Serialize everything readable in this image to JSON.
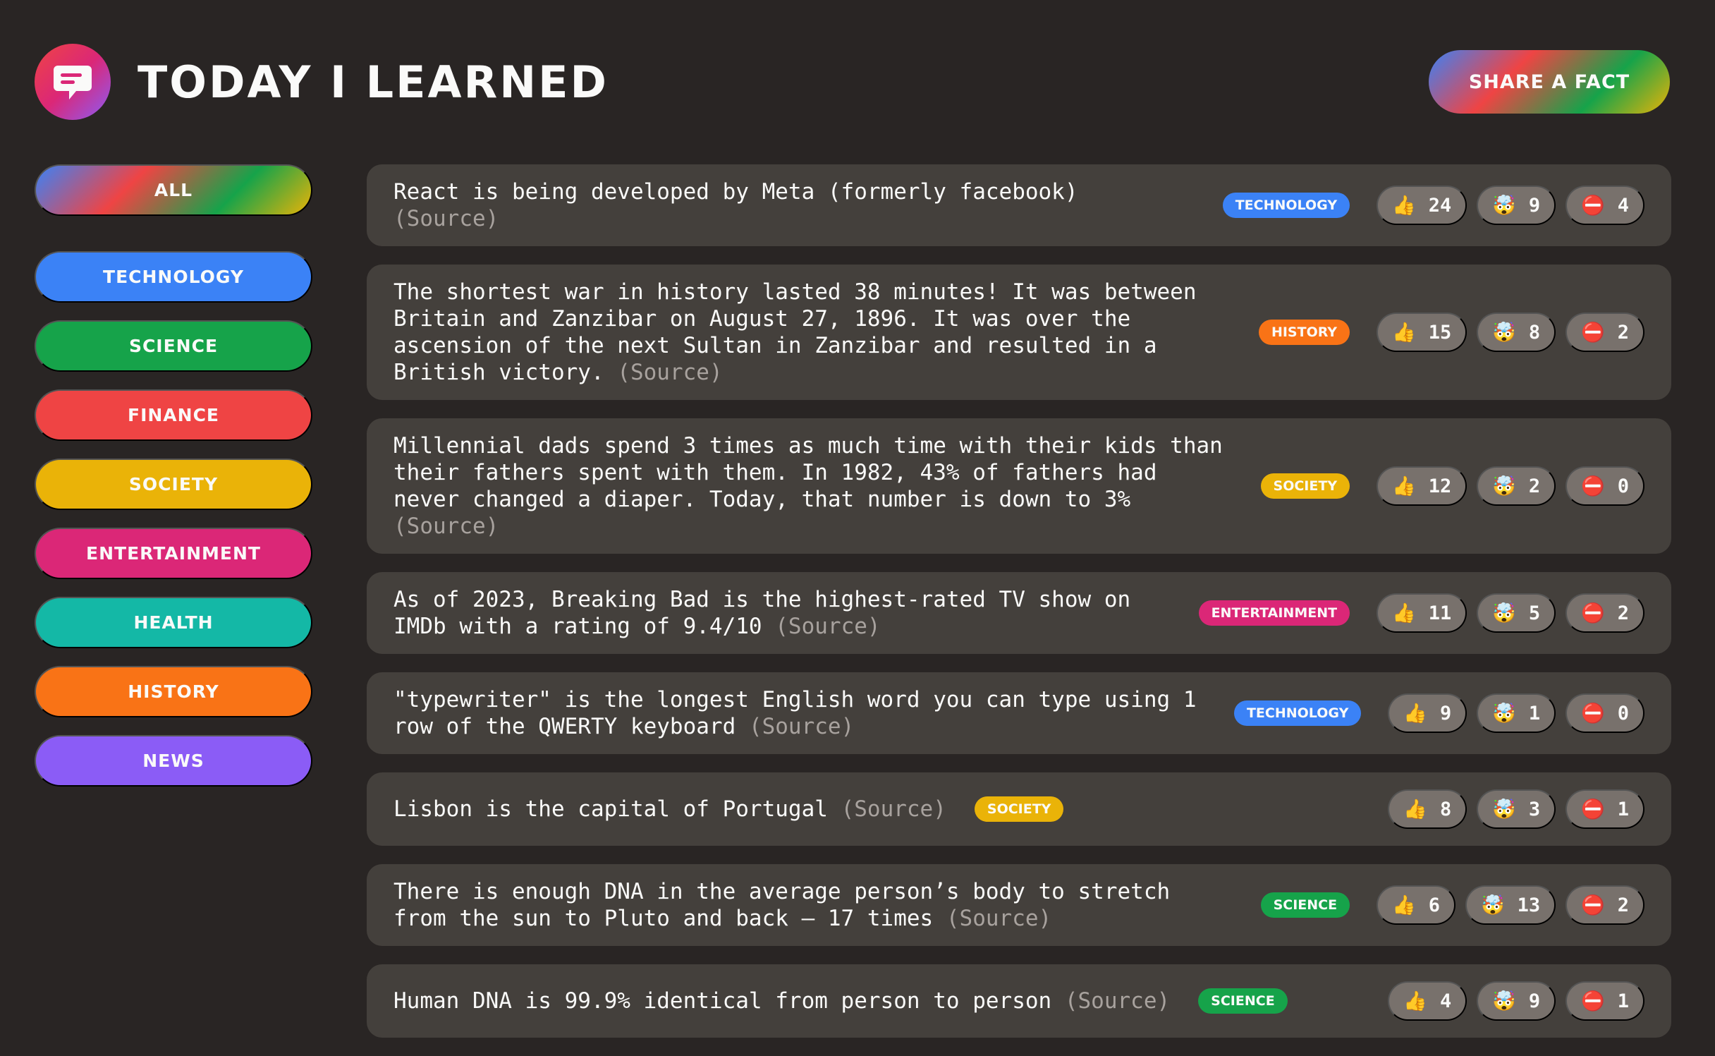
{
  "header": {
    "title": "Today I Learned",
    "share_label": "Share a fact"
  },
  "categories": [
    {
      "label": "All",
      "color": ""
    },
    {
      "label": "Technology",
      "color": "#3b82f6"
    },
    {
      "label": "Science",
      "color": "#16a34a"
    },
    {
      "label": "Finance",
      "color": "#ef4444"
    },
    {
      "label": "Society",
      "color": "#eab308"
    },
    {
      "label": "Entertainment",
      "color": "#db2777"
    },
    {
      "label": "Health",
      "color": "#14b8a6"
    },
    {
      "label": "History",
      "color": "#f97316"
    },
    {
      "label": "News",
      "color": "#8b5cf6"
    }
  ],
  "facts": [
    {
      "text": "React is being developed by Meta (formerly facebook)",
      "source": "(Source)",
      "category": "Technology",
      "color": "#3b82f6",
      "likes": "24",
      "mindblown": "9",
      "false": "4"
    },
    {
      "text": "The shortest war in history lasted 38 minutes! It was between Britain and Zanzibar on August 27, 1896. It was over the ascension of the next Sultan in Zanzibar and resulted in a British victory.",
      "source": "(Source)",
      "category": "History",
      "color": "#f97316",
      "likes": "15",
      "mindblown": "8",
      "false": "2"
    },
    {
      "text": "Millennial dads spend 3 times as much time with their kids than their fathers spent with them. In 1982, 43% of fathers had never changed a diaper. Today, that number is down to 3%",
      "source": "(Source)",
      "category": "Society",
      "color": "#eab308",
      "likes": "12",
      "mindblown": "2",
      "false": "0"
    },
    {
      "text": "As of 2023, Breaking Bad is the highest-rated TV show on IMDb with a rating of 9.4/10",
      "source": "(Source)",
      "category": "Entertainment",
      "color": "#db2777",
      "likes": "11",
      "mindblown": "5",
      "false": "2"
    },
    {
      "text": "\"typewriter\" is the longest English word you can type using 1 row of the QWERTY keyboard",
      "source": "(Source)",
      "category": "Technology",
      "color": "#3b82f6",
      "likes": "9",
      "mindblown": "1",
      "false": "0"
    },
    {
      "text": "Lisbon is the capital of Portugal",
      "source": "(Source)",
      "category": "Society",
      "color": "#eab308",
      "likes": "8",
      "mindblown": "3",
      "false": "1"
    },
    {
      "text": "There is enough DNA in the average person’s body to stretch from the sun to Pluto and back — 17 times",
      "source": "(Source)",
      "category": "Science",
      "color": "#16a34a",
      "likes": "6",
      "mindblown": "13",
      "false": "2"
    },
    {
      "text": "Human DNA is 99.9% identical from person to person",
      "source": "(Source)",
      "category": "Science",
      "color": "#16a34a",
      "likes": "4",
      "mindblown": "9",
      "false": "1"
    }
  ],
  "icons": {
    "logo": "speech-bubble-icon",
    "like": "👍",
    "mindblown": "🤯",
    "false": "⛔"
  }
}
